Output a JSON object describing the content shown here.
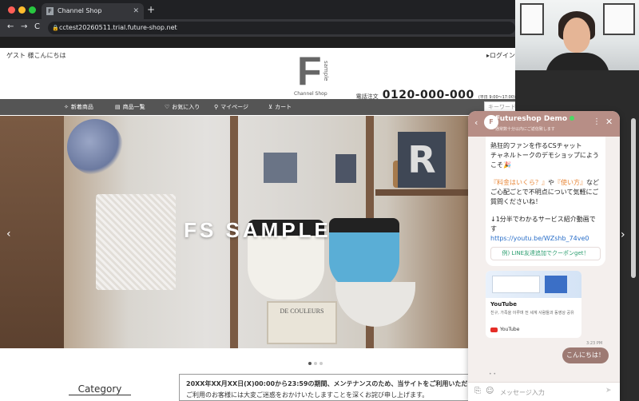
{
  "browser": {
    "tab_title": "Channel Shop",
    "tab_favicon": "F",
    "tab_close": "✕",
    "new_tab": "+",
    "back": "←",
    "forward": "→",
    "reload": "C",
    "lock": "🔒",
    "url": "cctest20260511.trial.future-shop.net"
  },
  "header": {
    "guest_greeting": "ゲスト 様こんにちは",
    "login_link": "▸ログイン",
    "logo_letter": "F",
    "logo_sample": "sample",
    "logo_sub": "Channel Shop",
    "tel_label": "電話注文",
    "tel_number": "0120-000-000",
    "tel_hours": "(平日 9:00～17:00)"
  },
  "nav": {
    "items": [
      {
        "icon": "✧",
        "label": "新着商品"
      },
      {
        "icon": "▤",
        "label": "商品一覧"
      },
      {
        "icon": "♡",
        "label": "お気に入り"
      },
      {
        "icon": "⚲",
        "label": "マイページ"
      },
      {
        "icon": "⊻",
        "label": "カート"
      }
    ],
    "search_placeholder": "キーワード検索",
    "search_icon": "🔍"
  },
  "hero": {
    "title": "FS SAMPLE",
    "sign_text": "DE COULEURS",
    "prev": "‹",
    "next": "›"
  },
  "content": {
    "category_title": "Category",
    "notice_line1": "20XX年XX月XX日(X)00:00から23:59の期間、メンテナンスのため、当サイトをご利用いただけま",
    "notice_line2": "ご利用のお客様には大変ご迷惑をおかけいたしますことを深くお詫び申し上げます。"
  },
  "chat": {
    "title": "Futureshop Demo",
    "status": "通常数十分以内にご返信致します",
    "back": "‹",
    "more": "⋮",
    "close": "✕",
    "avatar": "F",
    "msg_line1": "熱狂的ファンを作るCSチャット",
    "msg_line2": "チャネルトークのデモショップにようこそ🎉",
    "msg_q1": "『料金はいくら？』",
    "msg_q1_tail": "や",
    "msg_q2": "『使い方』",
    "msg_q2_tail": "など",
    "msg_line3": "ご心配ごとで不明点について気軽にご質問くださいね！",
    "msg_video_line": "↓1分半でわかるサービス紹介動画です",
    "msg_link": "https://youtu.be/WZshb_74ve0",
    "coupon_button": "例) LINE友達追加でクーポンget！",
    "yt_title": "YouTube",
    "yt_desc": "친구, 가족을 이루며 전 세계 사람들과 동영상 공유",
    "yt_source": "YouTube",
    "time": "3:23 PM",
    "user_msg": "こんにちは！",
    "typing": "• •",
    "input_placeholder": "メッセージ入力",
    "attach_icon": "⎘",
    "emoji_icon": "☺",
    "send_icon": "➤"
  }
}
